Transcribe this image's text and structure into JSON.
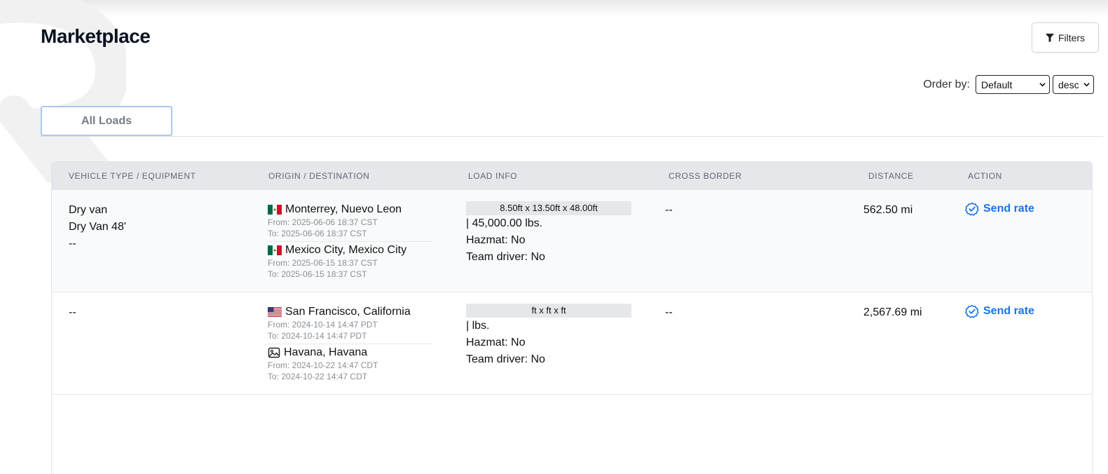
{
  "page": {
    "title": "Marketplace"
  },
  "toolbar": {
    "filters_label": "Filters",
    "order_by_label": "Order by:",
    "order_by_value": "Default",
    "direction_value": "desc"
  },
  "tabs": [
    {
      "label": "All Loads"
    }
  ],
  "table": {
    "headers": [
      "VEHICLE TYPE / EQUIPMENT",
      "ORIGIN / DESTINATION",
      "LOAD INFO",
      "CROSS BORDER",
      "DISTANCE",
      "ACTION"
    ],
    "rows": [
      {
        "vehicle": [
          "Dry van",
          "Dry Van 48'",
          "--"
        ],
        "origin": {
          "flag": "mexico-flag-icon",
          "place": "Monterrey, Nuevo Leon",
          "from": "From: 2025-06-06 18:37 CST",
          "to": "To: 2025-06-06 18:37 CST"
        },
        "destination": {
          "flag": "mexico-flag-icon",
          "place": "Mexico City, Mexico City",
          "from": "From: 2025-06-15 18:37 CST",
          "to": "To: 2025-06-15 18:37 CST"
        },
        "dims": "8.50ft x 13.50ft x 48.00ft",
        "weight": "| 45,000.00 lbs.",
        "hazmat": "Hazmat: No",
        "team": "Team driver: No",
        "cross_border": "--",
        "distance": "562.50 mi",
        "action": "Send rate"
      },
      {
        "vehicle": [
          "--"
        ],
        "origin": {
          "flag": "usa-flag-icon",
          "place": "San Francisco, California",
          "from": "From: 2024-10-14 14:47 PDT",
          "to": "To: 2024-10-14 14:47 PDT"
        },
        "destination": {
          "flag": "image-placeholder-icon",
          "place": "Havana, Havana",
          "from": "From: 2024-10-22 14:47 CDT",
          "to": "To: 2024-10-22 14:47 CDT"
        },
        "dims": "ft x ft x ft",
        "weight": "| lbs.",
        "hazmat": "Hazmat: No",
        "team": "Team driver: No",
        "cross_border": "--",
        "distance": "2,567.69 mi",
        "action": "Send rate"
      }
    ]
  },
  "colors": {
    "accent": "#1a73e8",
    "header_bg": "#e5e7eb",
    "tab_border": "#a9c8f5"
  }
}
